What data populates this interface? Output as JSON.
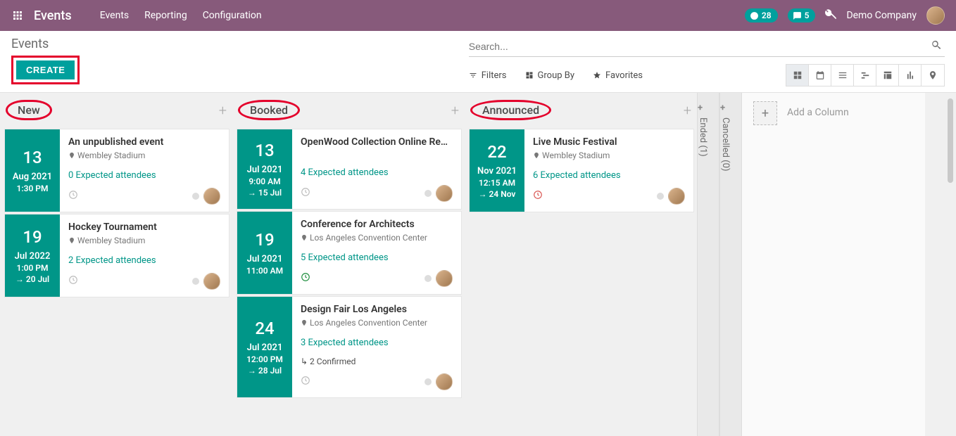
{
  "nav": {
    "title": "Events",
    "links": [
      "Events",
      "Reporting",
      "Configuration"
    ],
    "clock_badge": "28",
    "chat_badge": "5",
    "company": "Demo Company"
  },
  "control": {
    "breadcrumb": "Events",
    "create": "CREATE",
    "search_placeholder": "Search...",
    "filters": "Filters",
    "groupby": "Group By",
    "favorites": "Favorites"
  },
  "columns": [
    {
      "title": "New",
      "cards": [
        {
          "day": "13",
          "month": "Aug 2021",
          "time": "1:30 PM",
          "to": "",
          "title": "An unpublished event",
          "location": "Wembley Stadium",
          "attendees": "0 Expected attendees",
          "clock": "grey",
          "sub": ""
        },
        {
          "day": "19",
          "month": "Jul 2022",
          "time": "1:00 PM",
          "to": "→ 20 Jul",
          "title": "Hockey Tournament",
          "location": "Wembley Stadium",
          "attendees": "2 Expected attendees",
          "clock": "grey",
          "sub": ""
        }
      ]
    },
    {
      "title": "Booked",
      "cards": [
        {
          "day": "13",
          "month": "Jul 2021",
          "time": "9:00 AM",
          "to": "→ 15 Jul",
          "title": "OpenWood Collection Online Re…",
          "location": "",
          "attendees": "4 Expected attendees",
          "clock": "grey",
          "sub": ""
        },
        {
          "day": "19",
          "month": "Jul 2021",
          "time": "11:00 AM",
          "to": "",
          "title": "Conference for Architects",
          "location": "Los Angeles Convention Center",
          "attendees": "5 Expected attendees",
          "clock": "green",
          "sub": ""
        },
        {
          "day": "24",
          "month": "Jul 2021",
          "time": "12:00 PM",
          "to": "→ 28 Jul",
          "title": "Design Fair Los Angeles",
          "location": "Los Angeles Convention Center",
          "attendees": "3 Expected attendees",
          "clock": "grey",
          "sub": "↳ 2 Confirmed"
        }
      ]
    },
    {
      "title": "Announced",
      "cards": [
        {
          "day": "22",
          "month": "Nov 2021",
          "time": "12:15 AM",
          "to": "→ 24 Nov",
          "title": "Live Music Festival",
          "location": "Wembley Stadium",
          "attendees": "6 Expected attendees",
          "clock": "red",
          "sub": ""
        }
      ]
    }
  ],
  "folded": [
    {
      "label": "Ended (1)"
    },
    {
      "label": "Cancelled (0)"
    }
  ],
  "add_column": "Add a Column"
}
